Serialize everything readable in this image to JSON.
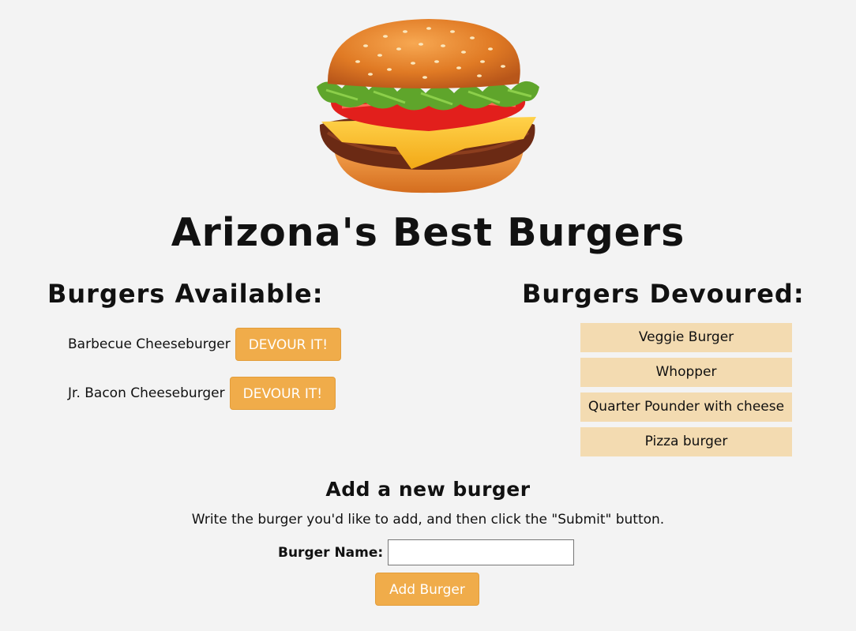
{
  "hero": {
    "image": "burger-illustration"
  },
  "page": {
    "title": "Arizona's Best Burgers"
  },
  "available": {
    "heading": "Burgers Available:",
    "items": [
      {
        "name": "Barbecue Cheeseburger",
        "button": "DEVOUR IT!"
      },
      {
        "name": "Jr. Bacon Cheeseburger",
        "button": "DEVOUR IT!"
      }
    ]
  },
  "devoured": {
    "heading": "Burgers Devoured:",
    "items": [
      "Veggie Burger",
      "Whopper",
      "Quarter Pounder with cheese",
      "Pizza burger"
    ]
  },
  "add_form": {
    "heading": "Add a new burger",
    "instructions": "Write the burger you'd like to add, and then click the \"Submit\" button.",
    "label": "Burger Name:",
    "input_value": "",
    "submit_label": "Add Burger"
  },
  "colors": {
    "background": "#f3f3f3",
    "button": "#f0ac4a",
    "devoured_item": "#f3dbb1"
  }
}
